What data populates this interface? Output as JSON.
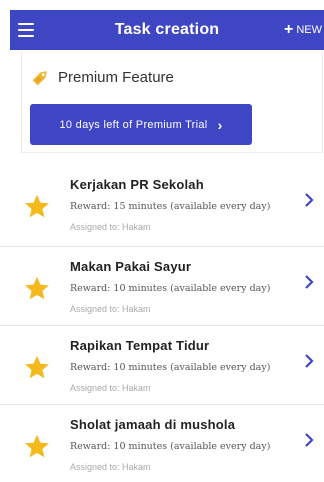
{
  "appbar": {
    "title": "Task creation",
    "new_label": "NEW",
    "menu_icon": "hamburger-menu-icon",
    "bg_color": "#3f46c4"
  },
  "premium": {
    "label": "Premium Feature",
    "icon": "tag-icon",
    "icon_color": "#f2b431",
    "trial_button_label": "10 days left of Premium Trial"
  },
  "tasks": [
    {
      "title": "Kerjakan PR Sekolah",
      "reward": "Reward: 15 minutes (available every day)",
      "assigned": "Assigned to: Hakam",
      "icon": "star-icon"
    },
    {
      "title": "Makan Pakai Sayur",
      "reward": "Reward: 10 minutes (available every day)",
      "assigned": "Assigned to: Hakam",
      "icon": "star-icon"
    },
    {
      "title": "Rapikan Tempat Tidur",
      "reward": "Reward: 10 minutes (available every day)",
      "assigned": "Assigned to: Hakam",
      "icon": "star-icon"
    },
    {
      "title": "Sholat jamaah di mushola",
      "reward": "Reward: 10 minutes (available every day)",
      "assigned": "Assigned to: Hakam",
      "icon": "star-icon"
    }
  ],
  "colors": {
    "accent": "#3f46c4",
    "star": "#f5b91e"
  }
}
